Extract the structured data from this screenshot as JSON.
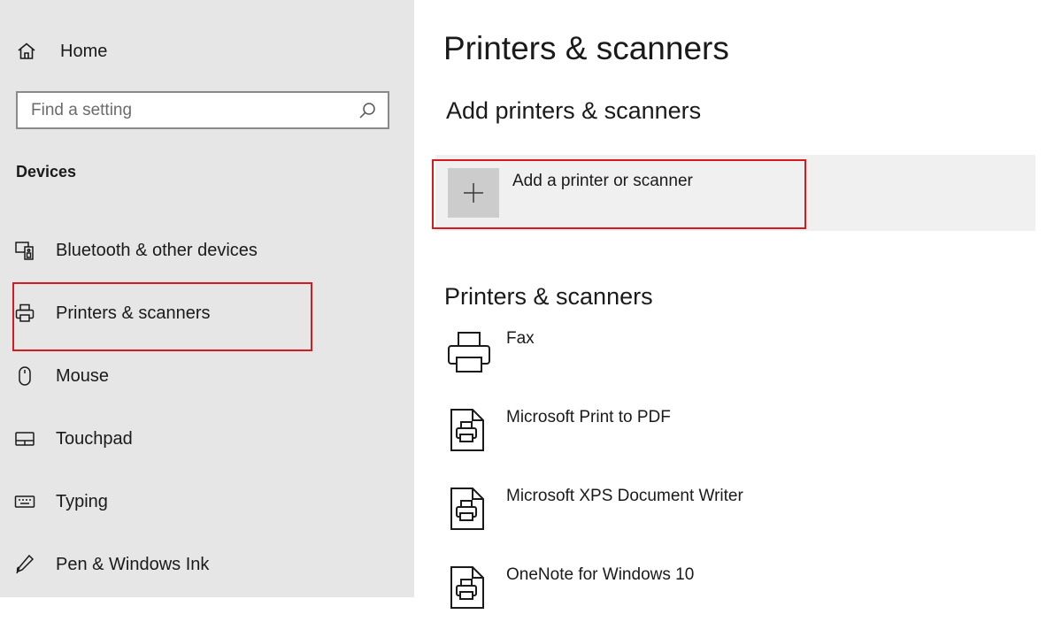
{
  "sidebar": {
    "home_label": "Home",
    "search_placeholder": "Find a setting",
    "section_label": "Devices",
    "items": [
      {
        "label": "Bluetooth & other devices",
        "icon": "bluetooth-devices-icon"
      },
      {
        "label": "Printers & scanners",
        "icon": "printer-icon",
        "selected": true
      },
      {
        "label": "Mouse",
        "icon": "mouse-icon"
      },
      {
        "label": "Touchpad",
        "icon": "touchpad-icon"
      },
      {
        "label": "Typing",
        "icon": "keyboard-icon"
      },
      {
        "label": "Pen & Windows Ink",
        "icon": "pen-icon"
      }
    ]
  },
  "main": {
    "title": "Printers & scanners",
    "add_section_title": "Add printers & scanners",
    "add_button_label": "Add a printer or scanner",
    "list_title": "Printers & scanners",
    "printers": [
      {
        "name": "Fax",
        "icon": "fax-printer-icon"
      },
      {
        "name": "Microsoft Print to PDF",
        "icon": "document-printer-icon"
      },
      {
        "name": "Microsoft XPS Document Writer",
        "icon": "document-printer-icon"
      },
      {
        "name": "OneNote for Windows 10",
        "icon": "document-printer-icon"
      }
    ]
  },
  "colors": {
    "sidebar_bg": "#e6e6e6",
    "highlight_border": "#d71920",
    "add_row_bg": "#f0f0f0",
    "add_tile_bg": "#cccccc"
  }
}
